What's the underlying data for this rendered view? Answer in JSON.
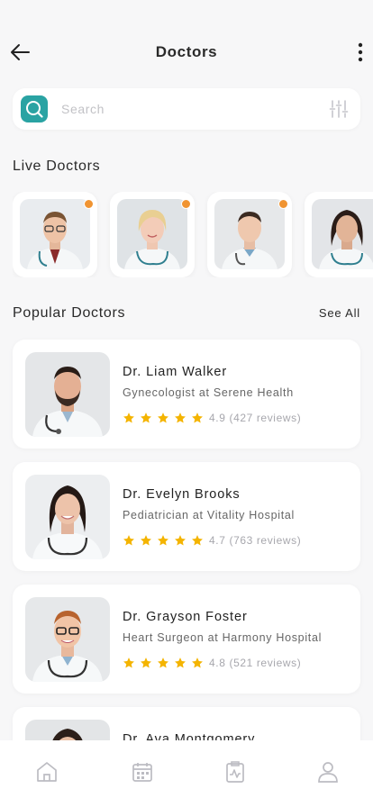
{
  "header": {
    "title": "Doctors"
  },
  "search": {
    "placeholder": "Search"
  },
  "live": {
    "title": "Live Doctors",
    "doctors": [
      {
        "photo": "doctor-glasses-male",
        "online": true
      },
      {
        "photo": "doctor-blonde-female",
        "online": true
      },
      {
        "photo": "doctor-young-male",
        "online": true
      },
      {
        "photo": "doctor-brunette-female",
        "online": true
      }
    ]
  },
  "popular": {
    "title": "Popular Doctors",
    "see_all": "See All",
    "doctors": [
      {
        "name": "Dr. Liam Walker",
        "specialty": "Gynecologist at Serene Health",
        "rating": "4.9",
        "reviews": "(427 reviews)"
      },
      {
        "name": "Dr. Evelyn Brooks",
        "specialty": "Pediatrician at Vitality Hospital",
        "rating": "4.7",
        "reviews": "(763 reviews)"
      },
      {
        "name": "Dr. Grayson Foster",
        "specialty": "Heart Surgeon at Harmony Hospital",
        "rating": "4.8",
        "reviews": "(521 reviews)"
      },
      {
        "name": "Dr. Ava Montgomery"
      }
    ]
  },
  "nav": [
    "home-icon",
    "calendar-icon",
    "health-chart-icon",
    "profile-icon"
  ],
  "colors": {
    "accent": "#2aa3a3",
    "star": "#f4b400",
    "online_dot": "#f09432",
    "background": "#f7f7f8"
  }
}
